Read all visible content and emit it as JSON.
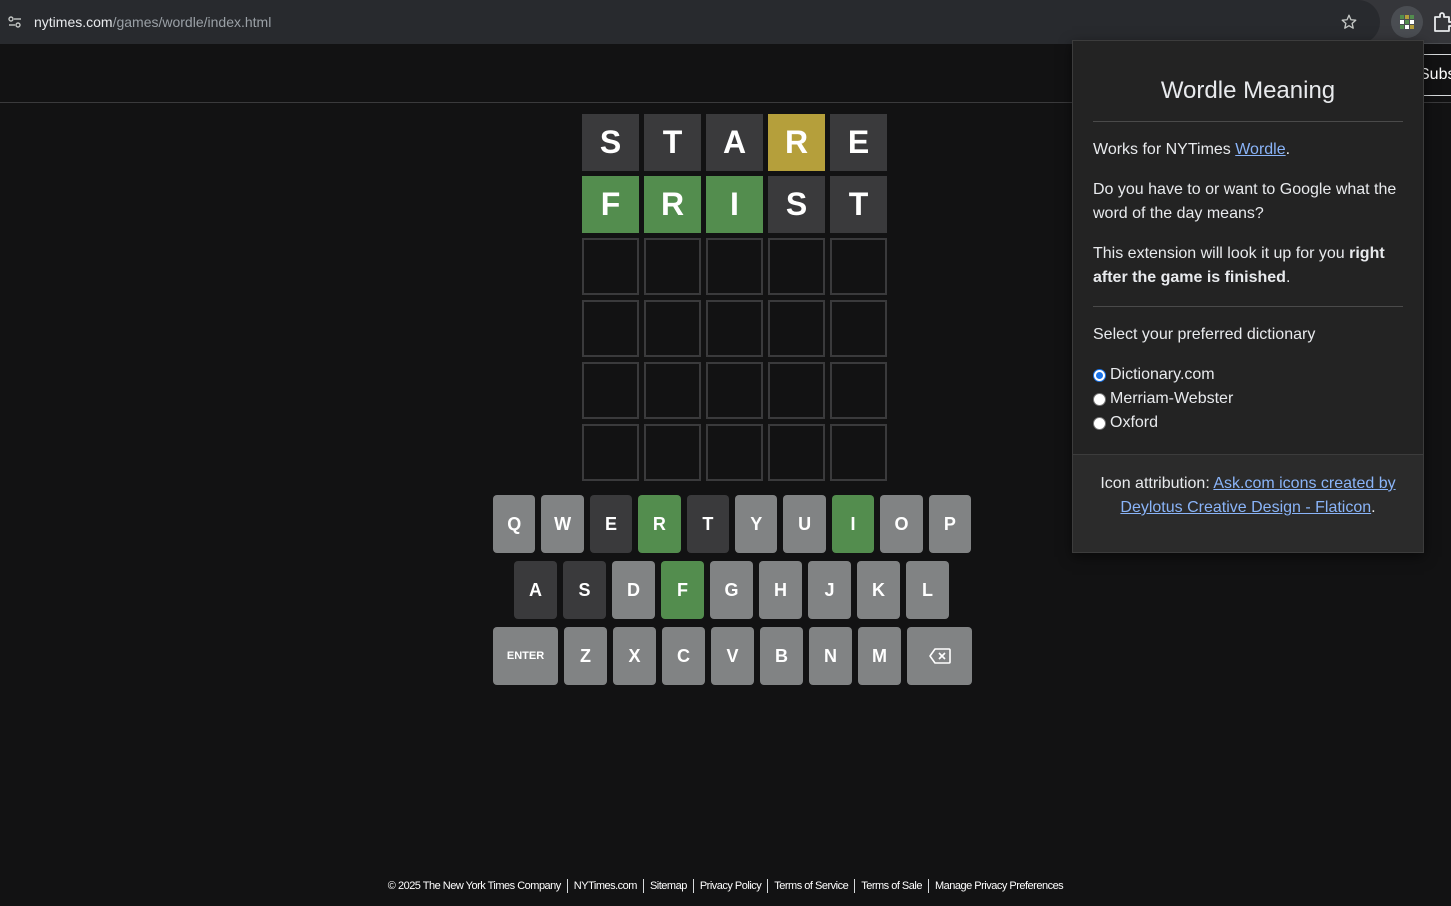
{
  "browser": {
    "url_host": "nytimes.com",
    "url_path": "/games/wordle/index.html"
  },
  "header": {
    "subscribe_label": "Subscribe"
  },
  "board": {
    "rows": [
      [
        {
          "letter": "S",
          "state": "absent"
        },
        {
          "letter": "T",
          "state": "absent"
        },
        {
          "letter": "A",
          "state": "absent"
        },
        {
          "letter": "R",
          "state": "present"
        },
        {
          "letter": "E",
          "state": "absent"
        }
      ],
      [
        {
          "letter": "F",
          "state": "correct"
        },
        {
          "letter": "R",
          "state": "correct"
        },
        {
          "letter": "I",
          "state": "correct"
        },
        {
          "letter": "S",
          "state": "absent"
        },
        {
          "letter": "T",
          "state": "absent"
        }
      ],
      [
        {
          "letter": "",
          "state": "empty"
        },
        {
          "letter": "",
          "state": "empty"
        },
        {
          "letter": "",
          "state": "empty"
        },
        {
          "letter": "",
          "state": "empty"
        },
        {
          "letter": "",
          "state": "empty"
        }
      ],
      [
        {
          "letter": "",
          "state": "empty"
        },
        {
          "letter": "",
          "state": "empty"
        },
        {
          "letter": "",
          "state": "empty"
        },
        {
          "letter": "",
          "state": "empty"
        },
        {
          "letter": "",
          "state": "empty"
        }
      ],
      [
        {
          "letter": "",
          "state": "empty"
        },
        {
          "letter": "",
          "state": "empty"
        },
        {
          "letter": "",
          "state": "empty"
        },
        {
          "letter": "",
          "state": "empty"
        },
        {
          "letter": "",
          "state": "empty"
        }
      ],
      [
        {
          "letter": "",
          "state": "empty"
        },
        {
          "letter": "",
          "state": "empty"
        },
        {
          "letter": "",
          "state": "empty"
        },
        {
          "letter": "",
          "state": "empty"
        },
        {
          "letter": "",
          "state": "empty"
        }
      ]
    ]
  },
  "keyboard": {
    "rows": [
      [
        {
          "key": "Q",
          "state": "unused"
        },
        {
          "key": "W",
          "state": "unused"
        },
        {
          "key": "E",
          "state": "absent"
        },
        {
          "key": "R",
          "state": "correct"
        },
        {
          "key": "T",
          "state": "absent"
        },
        {
          "key": "Y",
          "state": "unused"
        },
        {
          "key": "U",
          "state": "unused"
        },
        {
          "key": "I",
          "state": "correct"
        },
        {
          "key": "O",
          "state": "unused"
        },
        {
          "key": "P",
          "state": "unused"
        }
      ],
      [
        {
          "key": "A",
          "state": "absent"
        },
        {
          "key": "S",
          "state": "absent"
        },
        {
          "key": "D",
          "state": "unused"
        },
        {
          "key": "F",
          "state": "correct"
        },
        {
          "key": "G",
          "state": "unused"
        },
        {
          "key": "H",
          "state": "unused"
        },
        {
          "key": "J",
          "state": "unused"
        },
        {
          "key": "K",
          "state": "unused"
        },
        {
          "key": "L",
          "state": "unused"
        }
      ],
      [
        {
          "key": "ENTER",
          "state": "wide"
        },
        {
          "key": "Z",
          "state": "unused"
        },
        {
          "key": "X",
          "state": "unused"
        },
        {
          "key": "C",
          "state": "unused"
        },
        {
          "key": "V",
          "state": "unused"
        },
        {
          "key": "B",
          "state": "unused"
        },
        {
          "key": "N",
          "state": "unused"
        },
        {
          "key": "M",
          "state": "unused"
        },
        {
          "key": "backspace-icon",
          "state": "backspace"
        }
      ]
    ]
  },
  "footer": {
    "links": [
      "© 2025 The New York Times Company",
      "NYTimes.com",
      "Sitemap",
      "Privacy Policy",
      "Terms of Service",
      "Terms of Sale",
      "Manage Privacy Preferences"
    ]
  },
  "popup": {
    "title": "Wordle Meaning",
    "works_prefix": "Works for NYTimes ",
    "works_link": "Wordle",
    "works_suffix": ".",
    "question": "Do you have to or want to Google what the word of the day means?",
    "lookup_prefix": "This extension will look it up for you ",
    "lookup_bold": "right after the game is finished",
    "lookup_suffix": ".",
    "select_label": "Select your preferred dictionary",
    "options": [
      {
        "label": "Dictionary.com",
        "checked": true
      },
      {
        "label": "Merriam-Webster",
        "checked": false
      },
      {
        "label": "Oxford",
        "checked": false
      }
    ],
    "attribution_prefix": "Icon attribution: ",
    "attribution_link": "Ask.com icons created by Deylotus Creative Design - Flaticon",
    "attribution_suffix": "."
  },
  "colors": {
    "correct": "#538d4e",
    "present": "#b59f3b",
    "absent": "#3a3a3c",
    "unused_key": "#818384",
    "link": "#8ab4f8"
  }
}
